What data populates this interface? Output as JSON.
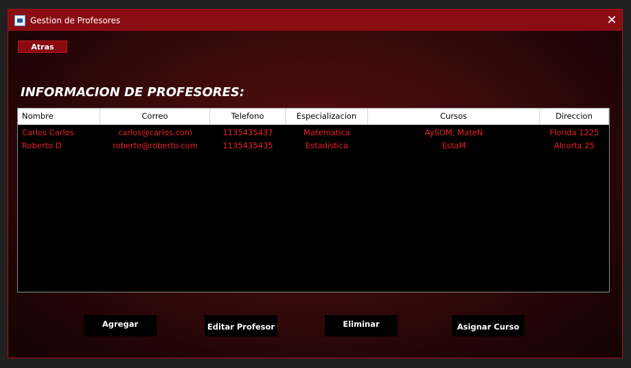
{
  "window": {
    "title": "Gestion de Profesores",
    "close_glyph": "✕",
    "accent_color": "#8a0d12",
    "app_icon": "form-icon"
  },
  "back_button": {
    "label": "Atras"
  },
  "heading": "INFORMACION DE PROFESORES:",
  "table": {
    "columns": [
      "Nombre",
      "Correo",
      "Telefono",
      "Especializacion",
      "Cursos",
      "Direccion"
    ],
    "rows": [
      [
        "Carlos Carlos",
        "carlos@carlos.com",
        "1135435437",
        "Matematica",
        "AySOM, MateN",
        "Florida 1225"
      ],
      [
        "Roberto D",
        "roberto@roberto.com",
        "1135435435",
        "Estadistica",
        "EstaM",
        "Alcorta 25"
      ]
    ],
    "cell_color": "#e8202a"
  },
  "actions": {
    "add": "Agregar",
    "edit": "Editar Profesor",
    "delete": "Eliminar",
    "assign": "Asignar Curso"
  }
}
